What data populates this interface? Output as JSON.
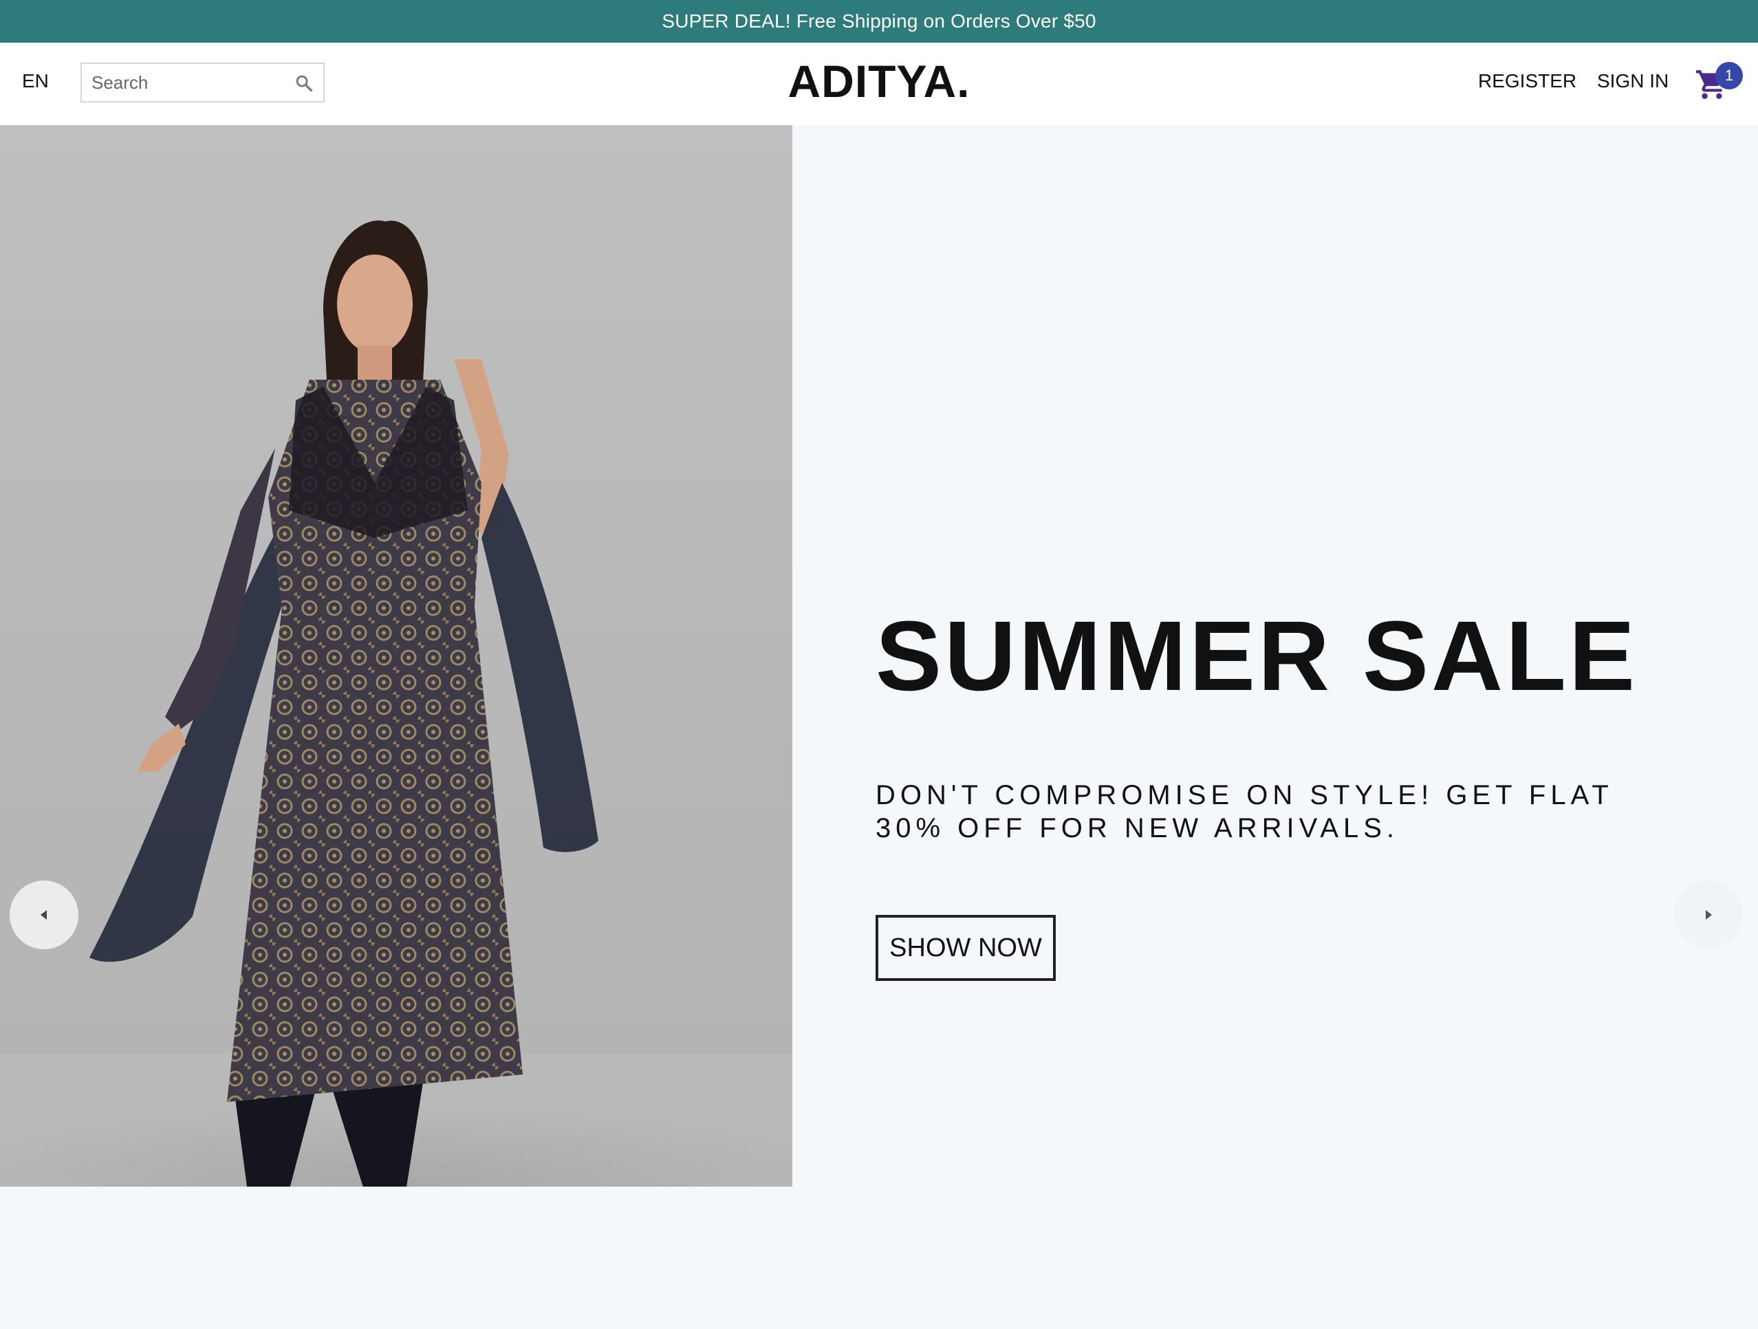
{
  "announcement": {
    "text": "SUPER DEAL! Free Shipping on Orders Over $50",
    "background": "#2e7b7b"
  },
  "navbar": {
    "language": "EN",
    "search": {
      "placeholder": "Search",
      "value": "",
      "icon": "search-icon"
    },
    "logo": "ADITYA.",
    "links": {
      "register": "REGISTER",
      "sign_in": "SIGN IN"
    },
    "cart": {
      "icon": "shopping-cart-icon",
      "badge_count": "1",
      "badge_color": "#3547a7"
    }
  },
  "hero": {
    "title": "SUMMER SALE",
    "description": "DON'T COMPROMISE ON STYLE! GET FLAT 30% OFF FOR NEW ARRIVALS.",
    "button_label": "SHOW NOW",
    "image_subject": "woman-in-printed-kurta-with-dupatta",
    "arrows": {
      "left": "arrow-left-icon",
      "right": "arrow-right-icon"
    },
    "background": "#f5f8fb"
  }
}
